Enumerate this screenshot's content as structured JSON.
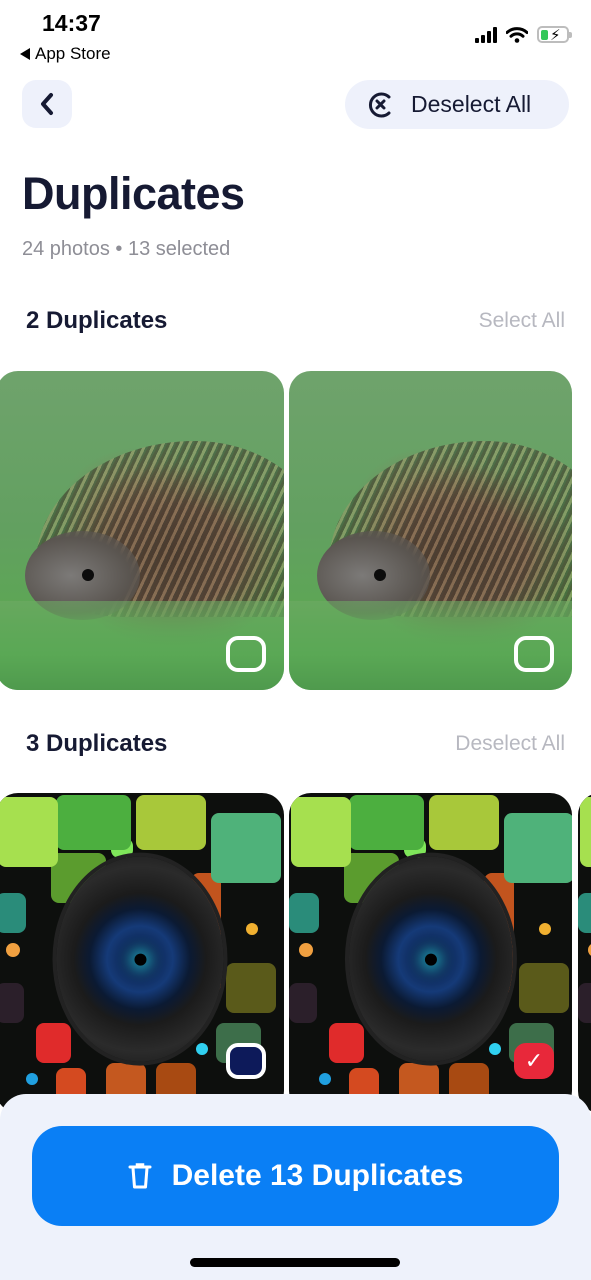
{
  "status_bar": {
    "time": "14:37",
    "back_app": "App Store",
    "icons": [
      "cellular-signal-icon",
      "wifi-icon",
      "battery-charging-icon"
    ]
  },
  "nav": {
    "back_icon": "chevron-left-icon",
    "deselect_all_icon": "circle-x-icon",
    "deselect_all_label": "Deselect All"
  },
  "header": {
    "title": "Duplicates",
    "subtitle": "24 photos • 13 selected"
  },
  "groups": [
    {
      "title": "2 Duplicates",
      "action": "Select All",
      "photos": [
        {
          "subject": "hedgehog in grass",
          "selected": false
        },
        {
          "subject": "hedgehog in grass",
          "selected": false
        }
      ]
    },
    {
      "title": "3 Duplicates",
      "action": "Deselect All",
      "photos": [
        {
          "subject": "camera lens mosaic",
          "selected": false
        },
        {
          "subject": "camera lens mosaic",
          "selected": true
        },
        {
          "subject": "camera lens mosaic",
          "selected": true
        }
      ]
    }
  ],
  "footer": {
    "delete_icon": "trash-icon",
    "delete_label": "Delete 13 Duplicates",
    "accent_color": "#0a7ff5",
    "selected_color": "#e8283a"
  },
  "check_glyph": "✓",
  "bolt_glyph": "⚡"
}
